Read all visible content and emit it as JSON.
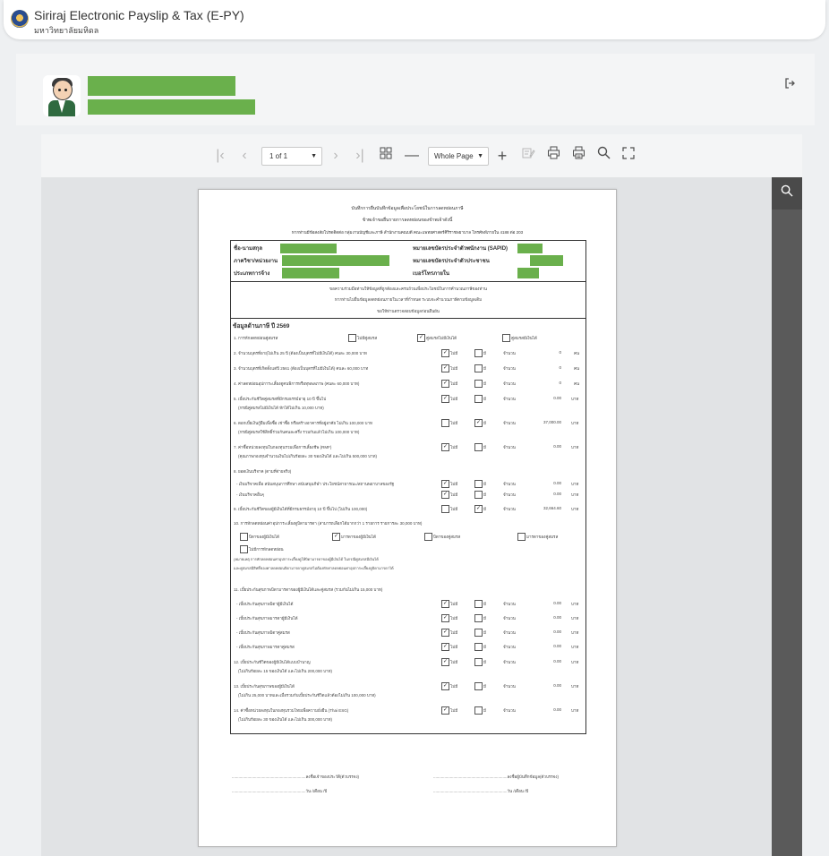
{
  "app": {
    "title": "Siriraj Electronic Payslip & Tax (E-PY)",
    "subtitle": "มหาวิทยาลัยมหิดล"
  },
  "profile": {
    "name_redacted": "",
    "id_redacted": ""
  },
  "toolbar": {
    "page_label": "1 of 1",
    "zoom_label": "Whole Page",
    "dropdown_arrow": "▼"
  },
  "colors": {
    "redaction_green": "#6ab04c",
    "sidebar_dark": "#5a5a5a"
  },
  "icons": [
    "first-page-icon",
    "previous-page-icon",
    "next-page-icon",
    "last-page-icon",
    "thumbnails-icon",
    "zoom-out-icon",
    "zoom-in-icon",
    "annotate-icon",
    "print-icon",
    "print-preview-icon",
    "search-icon",
    "fullscreen-icon",
    "logout-icon"
  ],
  "document": {
    "header_line1": "บันทึกการยื่นบันทึกข้อมูลเพื่อประโยชน์ในการลดหย่อนภาษี",
    "header_line2": "ข้าพเจ้าขอยื่นรายการลดหย่อนของข้าพเจ้าดังนี้",
    "header_line3": "หากท่านมีข้อสงสัยโปรดติดต่อ กลุ่มงานบัญชีและภาษี สำนักงานคณบดี คณะแพทยศาสตร์ศิริราชพยาบาล โทรศัพท์ภายใน 4188 ต่อ 203",
    "fields": {
      "name": "ชื่อ-นามสกุล",
      "department": "ภาควิชา/หน่วยงาน",
      "employment_type": "ประเภทการจ้าง",
      "sapid": "หมายเลขบัตรประจำตัวพนักงาน (SAPID)",
      "citizen_id": "หมายเลขบัตรประจำตัวประชาชน",
      "phone": "เบอร์โทรภายใน"
    },
    "notice_line1": "ขอความร่วมมือท่านให้ข้อมูลที่ถูกต้องและครบถ้วนเพื่อประโยชน์ในการคำนวณภาษีของท่าน",
    "notice_line2": "หากท่านไม่ยื่นข้อมูลลดหย่อนภายในเวลาที่กำหนด ระบบจะคำนวณภาษีตามข้อมูลเดิม",
    "notice_line3": "ขอให้ท่านตรวจสอบข้อมูลก่อนยืนยัน",
    "section_title": "ข้อมูลด้านภาษี ปี 2569",
    "marital": {
      "label": "1. การหักลดหย่อนคู่สมรส",
      "opt1": "ไม่มีคู่สมรส",
      "opt2": "คู่สมรสไม่มีเงินได้",
      "opt3": "คู่สมรสมีเงินได้"
    },
    "yes": "มี",
    "no": "ไม่มี",
    "amount_label": "จำนวน",
    "unit_person": "คน",
    "unit_baht": "บาท",
    "rows": [
      {
        "label": "2. จำนวนบุตรที่อายุไม่เกิน 25 ปี (ต้องเป็นบุตรที่ไม่มีเงินได้) คนละ 30,000 บาท",
        "sub": "",
        "yes": false,
        "amount": "0",
        "unit": "คน"
      },
      {
        "label": "3. จำนวนบุตรที่เกิดตั้งแต่ปี 2561 (ต้องเป็นบุตรที่ไม่มีเงินได้) คนละ 60,000 บาท",
        "sub": "",
        "yes": false,
        "amount": "0",
        "unit": "คน"
      },
      {
        "label": "4. ค่าลดหย่อนอุปการะเลี้ยงดูคนพิการหรือทุพพลภาพ (คนละ 60,000 บาท)",
        "sub": "",
        "yes": false,
        "amount": "0",
        "unit": "คน"
      },
      {
        "label": "5. เบี้ยประกันชีวิตคู่สมรสที่มีกรมธรรม์อายุ 10 ปี ขึ้นไป",
        "sub": "(กรณีคู่สมรสไม่มีเงินได้ หักได้ไม่เกิน 10,000 บาท)",
        "yes": false,
        "amount": "0.00",
        "unit": "บาท"
      },
      {
        "label": "6. ดอกเบี้ยเงินกู้ยืมเพื่อซื้อ เช่าซื้อ หรือสร้างอาคารที่อยู่อาศัย ไม่เกิน 100,000 บาท",
        "sub": "(กรณีคู่สมรสใช้สิทธิ์ร่วมกันคนละครึ่ง รวมกันแล้วไม่เกิน 100,000 บาท)",
        "yes": true,
        "amount": "37,000.00",
        "unit": "บาท"
      },
      {
        "label": "7. ค่าซื้อหน่วยลงทุนในกองทุนรวมเพื่อการเลี้ยงชีพ (RMF)",
        "sub": "(คุณภาพกองทุนจำนวนเงินไม่เกินร้อยละ 30 ของเงินได้ และไม่เกิน 500,000 บาท)",
        "yes": false,
        "amount": "0.00",
        "unit": "บาท"
      }
    ],
    "donation_title": "8. ยอดเงินบริจาค (ตามที่จ่ายจริง)",
    "donation_rows": [
      {
        "label": "- เงินบริจาคเพื่อ สนับสนุนการศึกษา สนับสนุนกีฬา ประโยชน์สาธารณะ/สถานพยาบาลของรัฐ",
        "yes": false,
        "amount": "0.00"
      },
      {
        "label": "- เงินบริจาคอื่นๆ",
        "yes": false,
        "amount": "0.00"
      }
    ],
    "row9": {
      "label": "9. เบี้ยประกันชีวิตของผู้มีเงินได้ที่มีกรมธรรม์อายุ 10 ปี ขึ้นไป (ไม่เกิน 100,000)",
      "yes": true,
      "amount": "32,664.60",
      "unit": "บาท"
    },
    "row10": {
      "label": "10. การหักลดหย่อนค่าอุปการะเลี้ยงดูบิดามารดา (สามารถเลือกได้มากกว่า 1 รายการ รายการละ 30,000 บาท)",
      "opt1": "บิดาของผู้มีเงินได้",
      "opt2": "มารดาของผู้มีเงินได้",
      "opt3": "บิดาของคู่สมรส",
      "opt4": "มารดาของคู่สมรส",
      "opt5": "ไม่มีการหักลดหย่อน",
      "note1": "(หมายเหตุ การหักลดหย่อนค่าอุปการะเลี้ยงดูให้บิดามารดาของผู้มีเงินได้ ในกรณีคู่สมรสมีเงินได้",
      "note2": "และคู่สมรสมีสิทธิ์ของค่าลดหย่อนบิดามารดาคู่สมรสไม่ต้องหักค่าลดหย่อนค่าอุปการะเลี้ยงดูบิดามารดาได้"
    },
    "row11_title": "11. เบี้ยประกันสุขภาพบิดามารดาของผู้มีเงินได้และคู่สมรส (รวมกันไม่เกิน 15,000 บาท)",
    "row11_items": [
      {
        "label": "- เบี้ยประกันสุขภาพบิดาผู้มีเงินได้",
        "amount": "0.00"
      },
      {
        "label": "- เบี้ยประกันสุขภาพมารดาผู้มีเงินได้",
        "amount": "0.00"
      },
      {
        "label": "- เบี้ยประกันสุขภาพบิดาคู่สมรส",
        "amount": "0.00"
      },
      {
        "label": "- เบี้ยประกันสุขภาพมารดาคู่สมรส",
        "amount": "0.00"
      }
    ],
    "tail_rows": [
      {
        "label": "12. เบี้ยประกันชีวิตของผู้มีเงินได้แบบบำนาญ",
        "sub": "(ไม่เกินร้อยละ 15 ของเงินได้ และไม่เกิน 200,000 บาท)",
        "amount": "0.00"
      },
      {
        "label": "13. เบี้ยประกันสุขภาพของผู้มีเงินได้",
        "sub": "(ไม่เกิน 25,000 บาทและเมื่อรวมกับเบี้ยประกันชีวิตแล้วต้องไม่เกิน 100,000 บาท)",
        "amount": "0.00"
      },
      {
        "label": "14. ค่าซื้อหน่วยลงทุนในกองทุนรวมไทยเพื่อความยั่งยืน (Thai ESG)",
        "sub": "(ไม่เกินร้อยละ 30 ของเงินได้ และไม่เกิน 300,000 บาท)",
        "amount": "0.00"
      }
    ],
    "sign_left": "..................................................................ลงชื่อเจ้าของประวัติ(ตัวบรรจง)",
    "sign_right": "..................................................................ลงชื่อผู้บันทึกข้อมูล(ตัวบรรจง)",
    "date_left": "..................................................................วัน  /เดือน  /ปี",
    "date_right": "..................................................................วัน  /เดือน  /ปี"
  }
}
